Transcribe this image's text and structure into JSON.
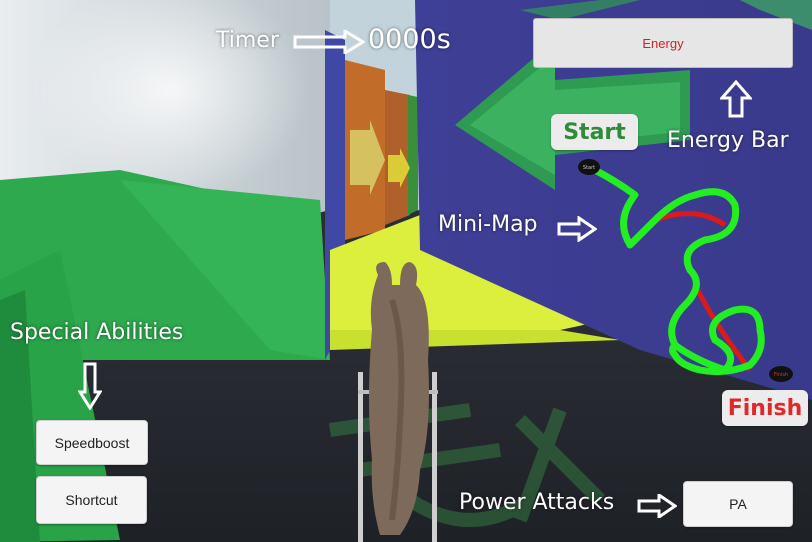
{
  "hud": {
    "timer_label": "Timer",
    "timer_value": "0000s",
    "energy_label": "Energy",
    "energy_bar_label": "Energy Bar",
    "minimap_label": "Mini-Map",
    "minimap_start_tag": "Start",
    "minimap_finish_tag": "Finish",
    "minimap_start_dot": "Start",
    "minimap_finish_dot": "Finish",
    "special_abilities_label": "Special Abilities",
    "power_attacks_label": "Power Attacks"
  },
  "buttons": {
    "speedboost": "Speedboost",
    "shortcut": "Shortcut",
    "power_attack": "PA"
  },
  "colors": {
    "energy_text": "#d21f1f",
    "start_text": "#2e8b3a",
    "finish_text": "#e02828",
    "minimap_track": "#22ee22",
    "minimap_shortcut": "#dd1a1a",
    "wall_green": "#2fae4f",
    "wall_blue": "#3a3f9a",
    "floor_yellow": "#dff03a"
  },
  "icons": [
    "arrow-right-icon",
    "arrow-up-icon",
    "arrow-down-icon"
  ]
}
